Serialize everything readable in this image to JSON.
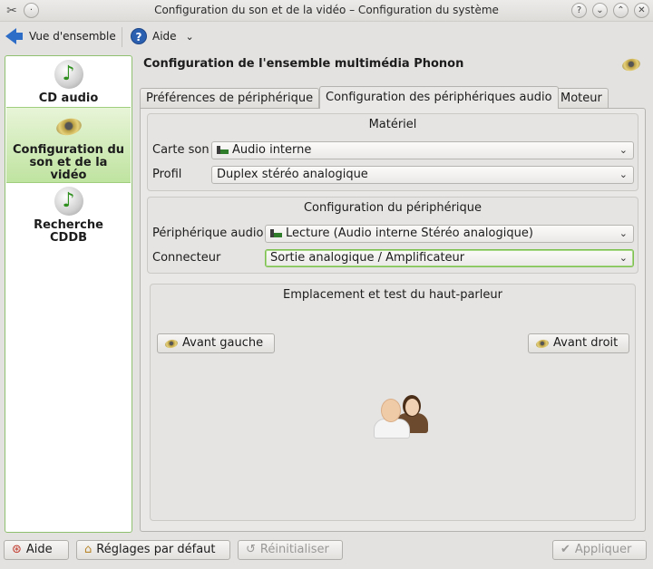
{
  "window": {
    "title": "Configuration du son et de la vidéo – Configuration du système",
    "controls": [
      "?",
      "⌄",
      "⌃",
      "✕"
    ]
  },
  "toolbar": {
    "overview_label": "Vue d'ensemble",
    "help_label": "Aide",
    "help_menu_glyph": "⌄"
  },
  "sidebar": {
    "items": [
      {
        "label": "CD audio",
        "icon": "cd-music-icon",
        "selected": false
      },
      {
        "label": "Configuration du son et de la vidéo",
        "icon": "speaker-icon",
        "selected": true
      },
      {
        "label": "Recherche CDDB",
        "icon": "cd-music-icon",
        "selected": false
      }
    ]
  },
  "main": {
    "title": "Configuration de l'ensemble multimédia Phonon",
    "tabs": [
      {
        "label": "Préférences de périphérique"
      },
      {
        "label": "Configuration des périphériques audio"
      },
      {
        "label": "Moteur"
      }
    ],
    "hardware": {
      "title": "Matériel",
      "sound_card_label": "Carte son",
      "sound_card_value": "Audio interne",
      "profile_label": "Profil",
      "profile_value": "Duplex stéréo analogique"
    },
    "device": {
      "title": "Configuration du périphérique",
      "audio_device_label": "Périphérique audio",
      "audio_device_value": "Lecture (Audio interne Stéréo analogique)",
      "connector_label": "Connecteur",
      "connector_value": "Sortie analogique / Amplificateur"
    },
    "speaker_test": {
      "title": "Emplacement et test du haut-parleur",
      "front_left": "Avant gauche",
      "front_right": "Avant droit"
    }
  },
  "bottom": {
    "help": "Aide",
    "defaults": "Réglages par défaut",
    "reset": "Réinitialiser",
    "apply": "Appliquer"
  },
  "colors": {
    "accent_green": "#8fc06f",
    "selection_bg": "#bfe3a0",
    "window_bg": "#e4e2e0"
  }
}
